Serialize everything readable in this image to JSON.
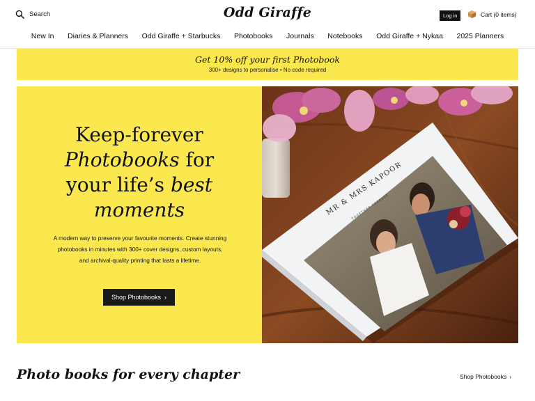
{
  "header": {
    "search_label": "Search",
    "logo_text": "Odd Giraffe",
    "login_label": "Log in",
    "cart_label": "Cart (0 items)"
  },
  "nav": {
    "items": [
      {
        "label": "New In"
      },
      {
        "label": "Diaries & Planners"
      },
      {
        "label": "Odd Giraffe + Starbucks"
      },
      {
        "label": "Photobooks"
      },
      {
        "label": "Journals"
      },
      {
        "label": "Notebooks"
      },
      {
        "label": "Odd Giraffe + Nykaa"
      },
      {
        "label": "2025 Planners"
      }
    ]
  },
  "promo": {
    "title": "Get 10% off your first Photobook",
    "subtitle": "300+ designs to personalise • No code required"
  },
  "hero": {
    "heading_line1": "Keep-forever",
    "heading_line2_italic": "Photobooks",
    "heading_line2_rest": " for",
    "heading_line3_rest": "your life’s ",
    "heading_line3_italic": "best",
    "heading_line4_italic": "moments",
    "description": "A modern way to preserve your favourite moments. Create stunning photobooks in minutes with 300+ cover designs, custom layouts, and archival-quality printing that lasts a lifetime.",
    "cta_label": "Shop Photobooks",
    "cta_icon": "chevron-right-icon",
    "image_book_title": "MR & MRS KAPOOR",
    "image_book_subtitle": "TOGETHER FOREVER"
  },
  "section": {
    "title": "Photo books for every chapter",
    "link_label": "Shop Photobooks",
    "link_icon": "chevron-right-icon"
  },
  "colors": {
    "accent_yellow": "#fbe84f",
    "button_dark": "#1a1a1a",
    "text": "#111111"
  }
}
